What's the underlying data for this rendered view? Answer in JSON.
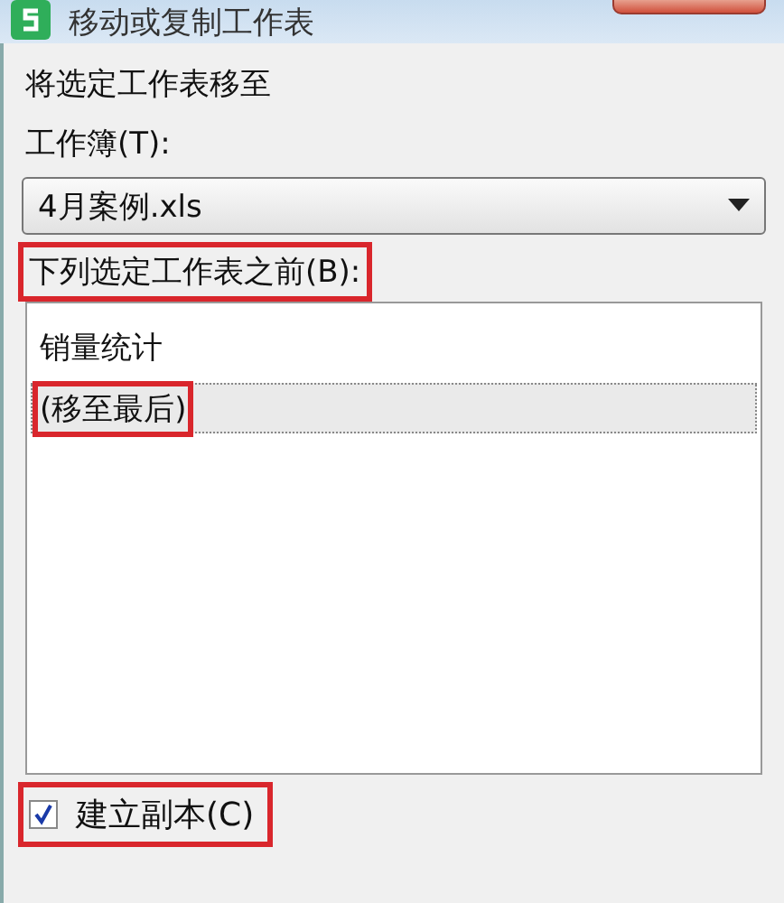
{
  "window": {
    "title": "移动或复制工作表"
  },
  "intro": "将选定工作表移至",
  "workbook": {
    "label": "工作簿(T):",
    "value": "4月案例.xls",
    "highlighted": false
  },
  "before": {
    "label": "下列选定工作表之前(B):",
    "highlighted": true
  },
  "sheets": [
    {
      "label": "销量统计",
      "selected": false,
      "highlighted": false
    },
    {
      "label": "(移至最后)",
      "selected": true,
      "highlighted": true
    }
  ],
  "copy": {
    "label": "建立副本(C)",
    "checked": true,
    "highlighted": true
  }
}
